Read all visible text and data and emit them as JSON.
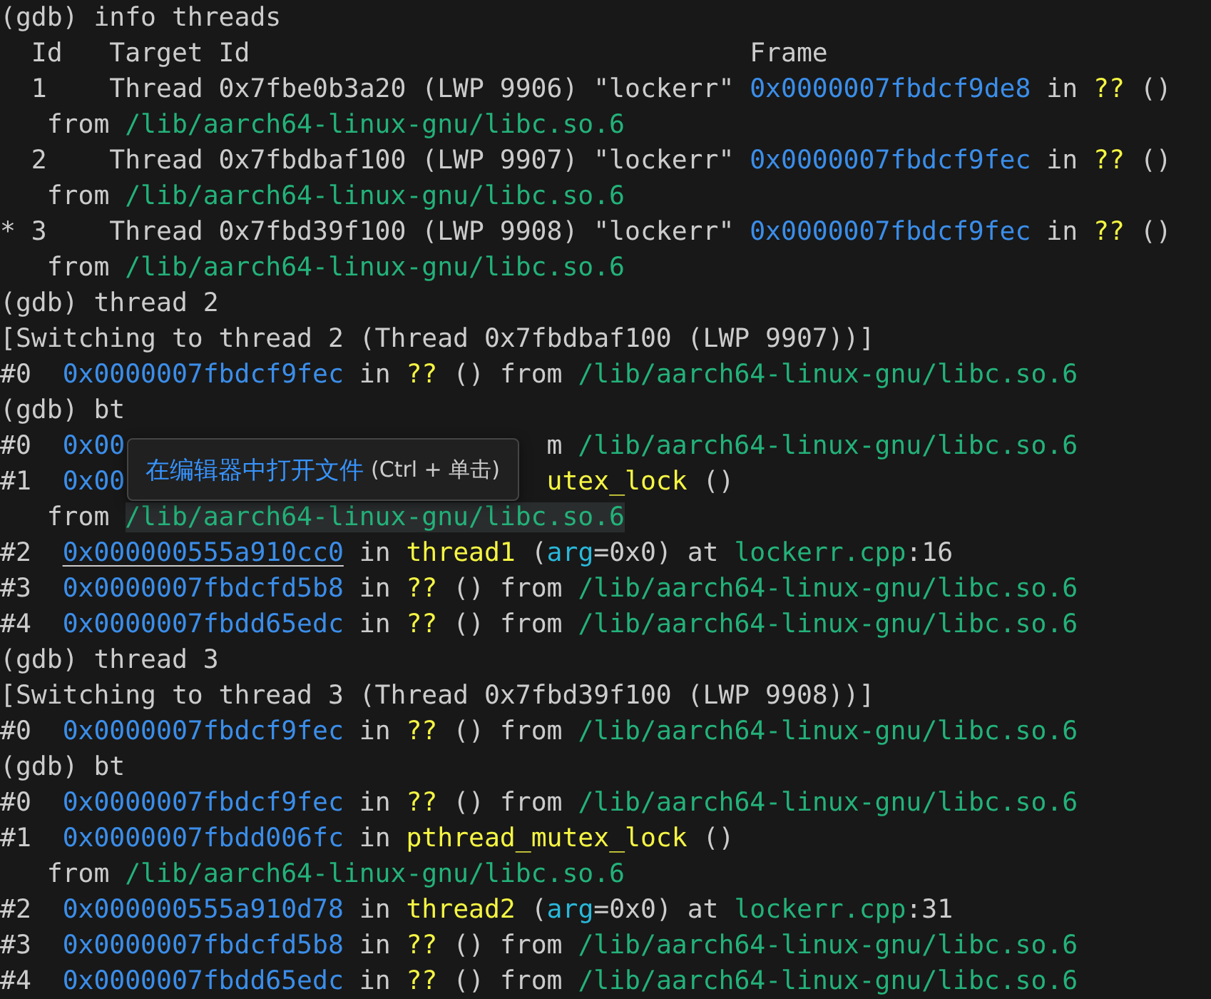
{
  "terminal": {
    "lines": [
      [
        {
          "t": "(gdb) info threads",
          "kind": "plain"
        }
      ],
      [
        {
          "t": "  Id   Target Id                                Frame",
          "kind": "plain"
        }
      ],
      [
        {
          "t": "  1    Thread 0x7fbe0b3a20 (LWP 9906) \"lockerr\" ",
          "kind": "plain"
        },
        {
          "t": "0x0000007fbdcf9de8",
          "kind": "addr"
        },
        {
          "t": " in ",
          "kind": "plain"
        },
        {
          "t": "??",
          "kind": "func"
        },
        {
          "t": " ()",
          "kind": "plain"
        }
      ],
      [
        {
          "t": "   from ",
          "kind": "plain"
        },
        {
          "t": "/lib/aarch64-linux-gnu/libc.so.6",
          "kind": "path"
        }
      ],
      [
        {
          "t": "  2    Thread 0x7fbdbaf100 (LWP 9907) \"lockerr\" ",
          "kind": "plain"
        },
        {
          "t": "0x0000007fbdcf9fec",
          "kind": "addr"
        },
        {
          "t": " in ",
          "kind": "plain"
        },
        {
          "t": "??",
          "kind": "func"
        },
        {
          "t": " ()",
          "kind": "plain"
        }
      ],
      [
        {
          "t": "   from ",
          "kind": "plain"
        },
        {
          "t": "/lib/aarch64-linux-gnu/libc.so.6",
          "kind": "path"
        }
      ],
      [
        {
          "t": "* 3    Thread 0x7fbd39f100 (LWP 9908) \"lockerr\" ",
          "kind": "plain"
        },
        {
          "t": "0x0000007fbdcf9fec",
          "kind": "addr"
        },
        {
          "t": " in ",
          "kind": "plain"
        },
        {
          "t": "??",
          "kind": "func"
        },
        {
          "t": " ()",
          "kind": "plain"
        }
      ],
      [
        {
          "t": "   from ",
          "kind": "plain"
        },
        {
          "t": "/lib/aarch64-linux-gnu/libc.so.6",
          "kind": "path"
        }
      ],
      [
        {
          "t": "(gdb) thread 2",
          "kind": "plain"
        }
      ],
      [
        {
          "t": "[Switching to thread 2 (Thread 0x7fbdbaf100 (LWP 9907))]",
          "kind": "plain"
        }
      ],
      [
        {
          "t": "#0  ",
          "kind": "plain"
        },
        {
          "t": "0x0000007fbdcf9fec",
          "kind": "addr"
        },
        {
          "t": " in ",
          "kind": "plain"
        },
        {
          "t": "??",
          "kind": "func"
        },
        {
          "t": " () from ",
          "kind": "plain"
        },
        {
          "t": "/lib/aarch64-linux-gnu/libc.so.6",
          "kind": "path"
        }
      ],
      [
        {
          "t": "(gdb) bt",
          "kind": "plain"
        }
      ],
      [
        {
          "t": "#0  ",
          "kind": "plain"
        },
        {
          "t": "0x00",
          "kind": "addr"
        },
        {
          "kind": "covered"
        },
        {
          "t": "m ",
          "kind": "plain"
        },
        {
          "t": "/lib/aarch64-linux-gnu/libc.so.6",
          "kind": "path"
        }
      ],
      [
        {
          "t": "#1  ",
          "kind": "plain"
        },
        {
          "t": "0x00",
          "kind": "addr"
        },
        {
          "kind": "covered"
        },
        {
          "t": "utex_lock",
          "kind": "func"
        },
        {
          "t": " ()",
          "kind": "plain"
        }
      ],
      [
        {
          "t": "   from ",
          "kind": "plain"
        },
        {
          "t": "/lib/aarch64-linux-gnu/libc.so.6",
          "kind": "path",
          "highlighted": true
        }
      ],
      [
        {
          "t": "#2  ",
          "kind": "plain"
        },
        {
          "t": "0x000000555a910cc0",
          "kind": "addr",
          "underlined": true
        },
        {
          "t": " in ",
          "kind": "plain"
        },
        {
          "t": "thread1",
          "kind": "func"
        },
        {
          "t": " (",
          "kind": "plain"
        },
        {
          "t": "arg",
          "kind": "param"
        },
        {
          "t": "=0x0) at ",
          "kind": "plain"
        },
        {
          "t": "lockerr.cpp",
          "kind": "path"
        },
        {
          "t": ":16",
          "kind": "plain"
        }
      ],
      [
        {
          "t": "#3  ",
          "kind": "plain"
        },
        {
          "t": "0x0000007fbdcfd5b8",
          "kind": "addr"
        },
        {
          "t": " in ",
          "kind": "plain"
        },
        {
          "t": "??",
          "kind": "func"
        },
        {
          "t": " () from ",
          "kind": "plain"
        },
        {
          "t": "/lib/aarch64-linux-gnu/libc.so.6",
          "kind": "path"
        }
      ],
      [
        {
          "t": "#4  ",
          "kind": "plain"
        },
        {
          "t": "0x0000007fbdd65edc",
          "kind": "addr"
        },
        {
          "t": " in ",
          "kind": "plain"
        },
        {
          "t": "??",
          "kind": "func"
        },
        {
          "t": " () from ",
          "kind": "plain"
        },
        {
          "t": "/lib/aarch64-linux-gnu/libc.so.6",
          "kind": "path"
        }
      ],
      [
        {
          "t": "(gdb) thread 3",
          "kind": "plain"
        }
      ],
      [
        {
          "t": "[Switching to thread 3 (Thread 0x7fbd39f100 (LWP 9908))]",
          "kind": "plain"
        }
      ],
      [
        {
          "t": "#0  ",
          "kind": "plain"
        },
        {
          "t": "0x0000007fbdcf9fec",
          "kind": "addr"
        },
        {
          "t": " in ",
          "kind": "plain"
        },
        {
          "t": "??",
          "kind": "func"
        },
        {
          "t": " () from ",
          "kind": "plain"
        },
        {
          "t": "/lib/aarch64-linux-gnu/libc.so.6",
          "kind": "path"
        }
      ],
      [
        {
          "t": "(gdb) bt",
          "kind": "plain"
        }
      ],
      [
        {
          "t": "#0  ",
          "kind": "plain"
        },
        {
          "t": "0x0000007fbdcf9fec",
          "kind": "addr"
        },
        {
          "t": " in ",
          "kind": "plain"
        },
        {
          "t": "??",
          "kind": "func"
        },
        {
          "t": " () from ",
          "kind": "plain"
        },
        {
          "t": "/lib/aarch64-linux-gnu/libc.so.6",
          "kind": "path"
        }
      ],
      [
        {
          "t": "#1  ",
          "kind": "plain"
        },
        {
          "t": "0x0000007fbdd006fc",
          "kind": "addr"
        },
        {
          "t": " in ",
          "kind": "plain"
        },
        {
          "t": "pthread_mutex_lock",
          "kind": "func"
        },
        {
          "t": " ()",
          "kind": "plain"
        }
      ],
      [
        {
          "t": "   from ",
          "kind": "plain"
        },
        {
          "t": "/lib/aarch64-linux-gnu/libc.so.6",
          "kind": "path"
        }
      ],
      [
        {
          "t": "#2  ",
          "kind": "plain"
        },
        {
          "t": "0x000000555a910d78",
          "kind": "addr"
        },
        {
          "t": " in ",
          "kind": "plain"
        },
        {
          "t": "thread2",
          "kind": "func"
        },
        {
          "t": " (",
          "kind": "plain"
        },
        {
          "t": "arg",
          "kind": "param"
        },
        {
          "t": "=0x0) at ",
          "kind": "plain"
        },
        {
          "t": "lockerr.cpp",
          "kind": "path"
        },
        {
          "t": ":31",
          "kind": "plain"
        }
      ],
      [
        {
          "t": "#3  ",
          "kind": "plain"
        },
        {
          "t": "0x0000007fbdcfd5b8",
          "kind": "addr"
        },
        {
          "t": " in ",
          "kind": "plain"
        },
        {
          "t": "??",
          "kind": "func"
        },
        {
          "t": " () from ",
          "kind": "plain"
        },
        {
          "t": "/lib/aarch64-linux-gnu/libc.so.6",
          "kind": "path"
        }
      ],
      [
        {
          "t": "#4  ",
          "kind": "plain"
        },
        {
          "t": "0x0000007fbdd65edc",
          "kind": "addr"
        },
        {
          "t": " in ",
          "kind": "plain"
        },
        {
          "t": "??",
          "kind": "func"
        },
        {
          "t": " () from ",
          "kind": "plain"
        },
        {
          "t": "/lib/aarch64-linux-gnu/libc.so.6",
          "kind": "path"
        }
      ]
    ]
  },
  "tooltip": {
    "action": "在编辑器中打开文件",
    "shortcut": "(Ctrl + 单击)"
  }
}
